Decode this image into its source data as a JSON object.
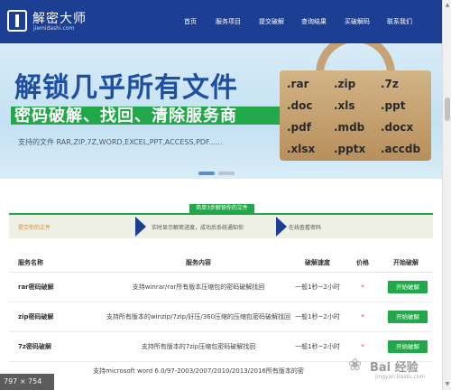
{
  "header": {
    "logo_title": "解密大师",
    "logo_sub": "jiemidashi.com",
    "nav": [
      "首页",
      "服务项目",
      "提交破解",
      "查询结果",
      "买破解码",
      "联系我们"
    ]
  },
  "banner": {
    "title": "解锁几乎所有文件",
    "subtitle": "密码破解、找回、清除服务商",
    "support": "支持的文件 RAR,ZIP,7Z,WORD,EXCEL,PPT,ACCESS,PDF......",
    "extensions": [
      ".rar",
      ".zip",
      ".7z",
      ".doc",
      ".xls",
      ".ppt",
      ".pdf",
      ".mdb",
      ".docx",
      ".xlsx",
      ".pptx",
      ".accdb"
    ]
  },
  "steps": {
    "title": "简单3步解锁你的文件",
    "items": [
      "提交你的文件",
      "实时显示解密进度，成功后系统通知你",
      "在线查看密码"
    ]
  },
  "table": {
    "headers": [
      "服务名称",
      "服务内容",
      "破解速度",
      "价格",
      "开始破解"
    ],
    "rows": [
      {
        "name": "rar密码破解",
        "desc": "支持winrar/rar所有版本压缩包的密码破解找回",
        "speed": "一般1秒~2小时",
        "price": "*",
        "action": "开始破解"
      },
      {
        "name": "zip密码破解",
        "desc": "支持所有版本的winzip/7zip/好压/360压缩的压缩包密码破解找回",
        "speed": "一般1秒~2小时",
        "price": "*",
        "action": "开始破解"
      },
      {
        "name": "7z密码破解",
        "desc": "支持所有版本的7zip压缩包密码破解找回",
        "speed": "一般1秒~2小时",
        "price": "*",
        "action": "开始破解"
      },
      {
        "name": "",
        "desc": "支持microsoft word 6.0/97-2003/2007/2010/2013/2016所有版本的密",
        "speed": "",
        "price": "",
        "action": ""
      }
    ]
  },
  "overlay": {
    "size_badge": "797 × 754",
    "watermark_text": "Bai 经验",
    "watermark_url": "jingyan.baidu.com"
  },
  "colors": {
    "header_bg": "#1c3f94",
    "accent_green": "#22a84a",
    "title_blue": "#1e4fa3",
    "step_orange": "#e08a1a"
  }
}
